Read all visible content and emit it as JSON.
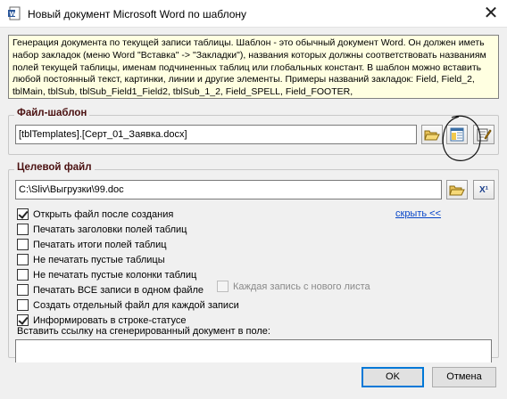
{
  "window": {
    "title": "Новый документ Microsoft Word по шаблону",
    "close_glyph": "✕"
  },
  "info_text": "Генерация документа по текущей записи таблицы. Шаблон - это обычный документ Word. Он должен иметь набор закладок (меню Word \"Вставка\" -> \"Закладки\"), названия которых должны соответствовать названиям полей текущей таблицы, именам подчиненных таблиц или глобальных констант. В шаблон можно вставить любой постоянный текст, картинки, линии и другие элементы. Примеры названий закладок: Field, Field_2, tblMain, tblSub, tblSub_Field1_Field2, tblSub_1_2, Field_SPELL, Field_FOOTER,",
  "template_group": {
    "label": "Файл-шаблон",
    "value": "[tblTemplates].[Серт_01_Заявка.docx]"
  },
  "target_group": {
    "label": "Целевой файл",
    "value": "C:\\Sliv\\Выгрузки\\99.doc",
    "hide_link": "скрыть <<",
    "x_button": "X¹"
  },
  "options": [
    {
      "label": "Открыть файл после создания",
      "checked": true
    },
    {
      "label": "Печатать заголовки полей таблиц",
      "checked": false
    },
    {
      "label": "Печатать итоги полей таблиц",
      "checked": false
    },
    {
      "label": "Не печатать пустые таблицы",
      "checked": false
    },
    {
      "label": "Не печатать пустые колонки таблиц",
      "checked": false
    },
    {
      "label": "Печатать ВСЕ записи в одном файле",
      "checked": false
    },
    {
      "label": "Создать отдельный файл для каждой записи",
      "checked": false
    },
    {
      "label": "Информировать в строке-статусе",
      "checked": true
    }
  ],
  "each_record_new_sheet": {
    "label": "Каждая запись с нового листа",
    "checked": false,
    "enabled": false
  },
  "insert_link_label": "Вставить ссылку на сгенерированный документ в поле:",
  "buttons": {
    "ok": "OK",
    "cancel": "Отмена"
  },
  "colors": {
    "info_bg": "#ffffe1",
    "group_label": "#4a1010",
    "link": "#0645c8",
    "default_border": "#0078d7"
  }
}
